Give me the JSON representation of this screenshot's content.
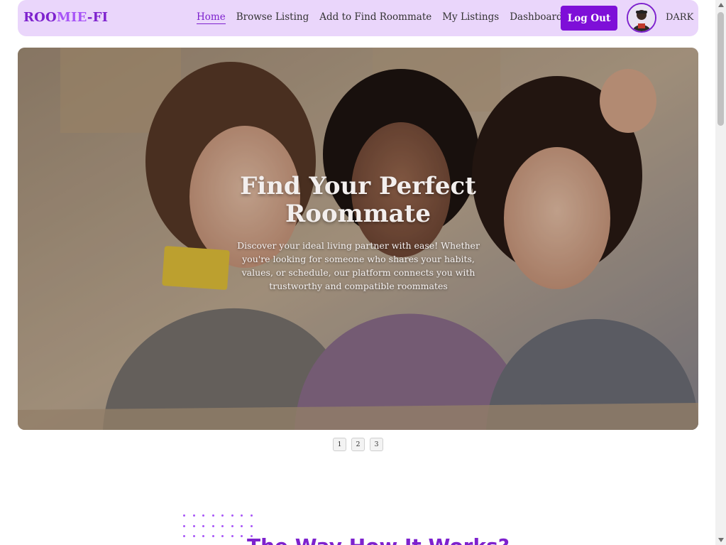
{
  "brand": {
    "logo_part1": "ROO",
    "logo_part2": "MIE",
    "logo_part3": "-FI",
    "accent_color": "#7e22ce",
    "nav_bg_color": "#ead6fb"
  },
  "nav": {
    "items": [
      {
        "label": "Home",
        "active": true
      },
      {
        "label": "Browse Listing",
        "active": false
      },
      {
        "label": "Add to Find Roommate",
        "active": false
      },
      {
        "label": "My Listings",
        "active": false
      },
      {
        "label": "Dashboard",
        "active": false
      }
    ],
    "logout_label": "Log Out",
    "avatar_icon": "user-avatar-icon",
    "theme_toggle_label": "DARK"
  },
  "hero": {
    "title": "Find Your Perfect Roommate",
    "description": "Discover your ideal living partner with ease! Whether you're looking for someone who shares your habits, values, or schedule, our platform connects you with trustworthy and compatible roommates"
  },
  "carousel": {
    "pages": [
      "1",
      "2",
      "3"
    ]
  },
  "section": {
    "title": "The Way How It Works?"
  }
}
